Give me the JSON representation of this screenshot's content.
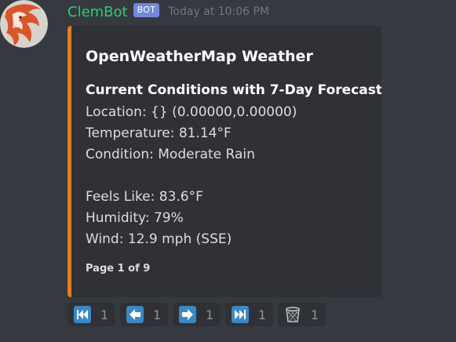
{
  "message": {
    "username": "ClemBot",
    "bot_tag": "BOT",
    "timestamp": "Today at 10:06 PM",
    "username_color": "#2ecc71"
  },
  "embed": {
    "accent_color": "#e67e22",
    "title": "OpenWeatherMap Weather",
    "subtitle": "Current Conditions with 7-Day Forecast",
    "location": "Location: {} (0.00000,0.00000)",
    "temperature": "Temperature: 81.14°F",
    "condition": "Condition: Moderate Rain",
    "feels_like": "Feels Like: 83.6°F",
    "humidity": "Humidity: 79%",
    "wind": "Wind: 12.9 mph (SSE)",
    "footer": "Page 1 of 9"
  },
  "reactions": [
    {
      "icon": "first-page-icon",
      "count": "1"
    },
    {
      "icon": "previous-page-icon",
      "count": "1"
    },
    {
      "icon": "next-page-icon",
      "count": "1"
    },
    {
      "icon": "last-page-icon",
      "count": "1"
    },
    {
      "icon": "wastebasket-icon",
      "count": "1"
    }
  ]
}
